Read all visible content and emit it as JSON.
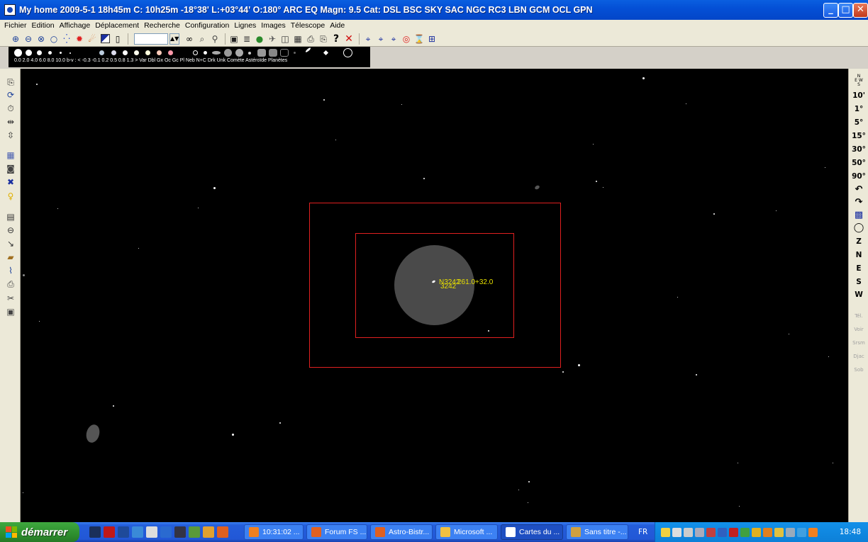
{
  "window": {
    "title": "My home 2009-5-1  18h45m C: 10h25m -18°38' L:+03°44' O:180° ARC EQ Magn: 9.5 Cat: DSL BSC SKY SAC NGC RC3 LBN GCM OCL GPN",
    "minimize": "_",
    "maximize": "□",
    "close": "✕"
  },
  "menu": [
    "Fichier",
    "Edition",
    "Affichage",
    "Déplacement",
    "Recherche",
    "Configuration",
    "Lignes",
    "Images",
    "Télescope",
    "Aide"
  ],
  "toolbar": {
    "icons": [
      "zoom-in-icon",
      "zoom-out-icon",
      "zoom-fit-icon",
      "zoom-icon",
      "constellation-icon",
      "sun-icon",
      "comet-icon",
      "color-icon",
      "page-icon"
    ],
    "icons2": [
      "binoculars-icon",
      "find-icon",
      "search-people-icon"
    ],
    "icons3": [
      "save-icon",
      "list-icon",
      "planet-icon",
      "satellite-icon",
      "calendar-icon",
      "calc-icon",
      "print-icon",
      "print-preview-icon",
      "help-icon",
      "close-red-icon"
    ],
    "icons4": [
      "telescope1-icon",
      "telescope2-icon",
      "telescope3-icon",
      "target-icon",
      "ocular-icon",
      "grid-icon"
    ],
    "help_glyph": "?",
    "close_glyph": "✕"
  },
  "legend": {
    "labels": "0.0  2.0  4.0  6.0  8.0 10.0 b-v : <  -0.3 -0.1  0.2  0.5  0.8  1.3  >    Var  Dbl  Gx  Oc  Gc  Pl   Neb N+C Drk  Unk Comète Astéroïde Planètes"
  },
  "rightbar": {
    "items": [
      "10'",
      "1°",
      "5°",
      "15°",
      "30°",
      "50°",
      "90°"
    ],
    "directions": [
      "Z",
      "N",
      "E",
      "S",
      "W"
    ],
    "gray_items": [
      "Tél.",
      "Voir",
      "Srsm",
      "Djac",
      "Sob"
    ]
  },
  "sky": {
    "object_label_1": "N3242",
    "object_label_2": "3242",
    "object_label_3": "261.0+32.0"
  },
  "taskbar": {
    "start": "démarrer",
    "tasks": [
      "10:31:02 ...",
      "Forum FS ...",
      "Astro-Bistr...",
      "Microsoft ...",
      "Cartes du ...",
      "Sans titre -..."
    ],
    "lang": "FR",
    "clock": "18:48"
  },
  "colors": {
    "title_bar": "#0450d6",
    "sky_bg": "#000000",
    "fov_rect": "#e02020",
    "label": "#e8e000",
    "start": "#2e8f2e"
  }
}
